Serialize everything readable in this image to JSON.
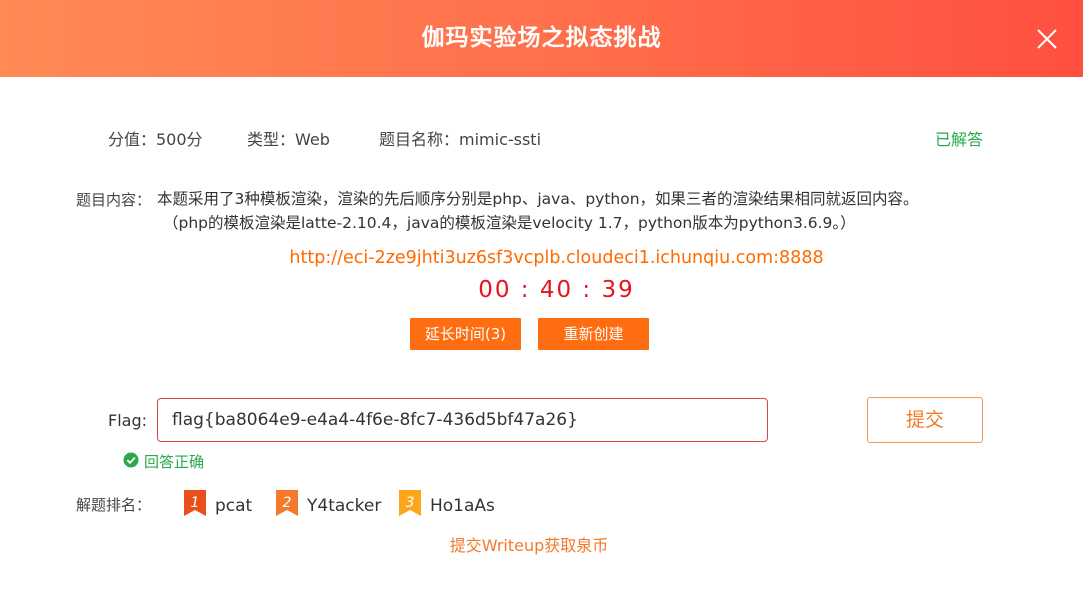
{
  "dialog": {
    "title": "伽玛实验场之拟态挑战"
  },
  "meta": {
    "score": "分值：500分",
    "type": "类型：Web",
    "name": "题目名称：mimic-ssti",
    "status": "已解答"
  },
  "content": {
    "label": "题目内容：",
    "line1": "本题采用了3种模板渲染，渲染的先后顺序分别是php、java、python，如果三者的渲染结果相同就返回内容。",
    "line2": "（php的模板渲染是latte-2.10.4，java的模板渲染是velocity 1.7，python版本为python3.6.9。）"
  },
  "challenge": {
    "url": "http://eci-2ze9jhti3uz6sf3vcplb.cloudeci1.ichunqiu.com:8888",
    "timer": "00 : 40 : 39",
    "extend_label": "延长时间(3)",
    "recreate_label": "重新创建"
  },
  "flag": {
    "label": "Flag:",
    "value": "flag{ba8064e9-e4a4-4f6e-8fc7-436d5bf47a26}",
    "submit_label": "提交",
    "result": "回答正确"
  },
  "ranking": {
    "label": "解题排名：",
    "items": [
      {
        "rank": "1",
        "name": "pcat",
        "color": "#e84f1b"
      },
      {
        "rank": "2",
        "name": "Y4tacker",
        "color": "#f5792a"
      },
      {
        "rank": "3",
        "name": "Ho1aAs",
        "color": "#fba51a"
      }
    ]
  },
  "writeup_link": "提交Writeup获取泉币",
  "colors": {
    "accent": "#ff6d12",
    "success": "#2aa84a",
    "timer": "#e5141d"
  }
}
